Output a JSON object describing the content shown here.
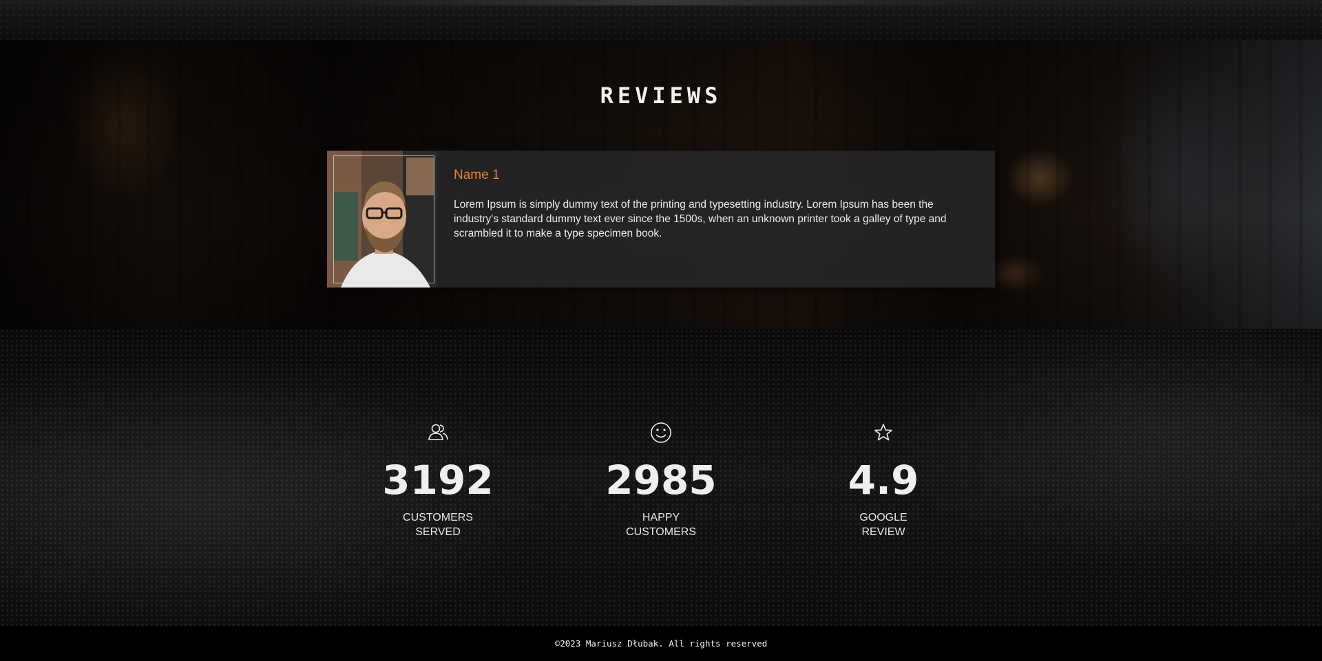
{
  "reviews": {
    "title": "REVIEWS",
    "items": [
      {
        "name": "Name 1",
        "text": "Lorem Ipsum is simply dummy text of the printing and typesetting industry. Lorem Ipsum has been the industry's standard dummy text ever since the 1500s, when an unknown printer took a galley of type and scrambled it to make a type specimen book.",
        "avatar": "reviewer-photo"
      }
    ]
  },
  "stats": [
    {
      "icon": "users-icon",
      "value": "3192",
      "label": "CUSTOMERS SERVED"
    },
    {
      "icon": "smiley-icon",
      "value": "2985",
      "label": "HAPPY CUSTOMERS"
    },
    {
      "icon": "star-icon",
      "value": "4.9",
      "label": "GOOGLE REVIEW"
    }
  ],
  "footer": {
    "copyright": "©2023 Mariusz Dłubak. All rights reserved"
  },
  "colors": {
    "accent": "#e8832a",
    "background": "#000000",
    "card": "#282828"
  }
}
